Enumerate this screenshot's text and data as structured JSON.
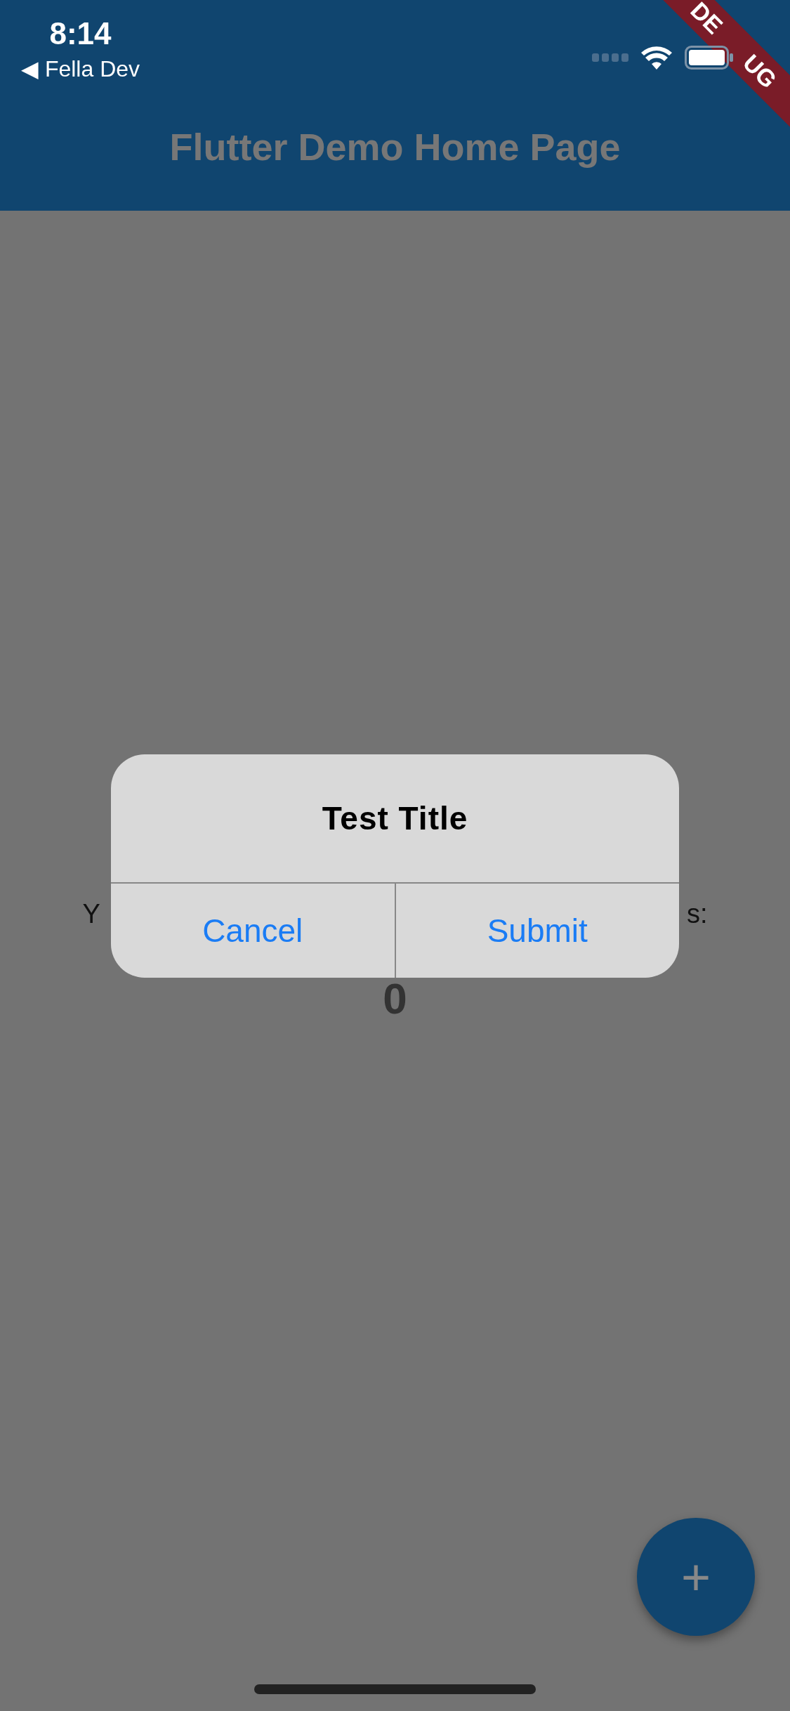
{
  "status_bar": {
    "time": "8:14",
    "back_label": "◀ Fella Dev"
  },
  "debug_banner": {
    "start": "DE",
    "end": "UG"
  },
  "app_bar": {
    "title": "Flutter Demo Home Page"
  },
  "body": {
    "counter_label_start": "Y",
    "counter_label_end": "s:",
    "counter": "0"
  },
  "dialog": {
    "title": "Test Title",
    "actions": [
      {
        "label": "Cancel"
      },
      {
        "label": "Submit"
      }
    ]
  },
  "fab": {
    "label": "+"
  }
}
